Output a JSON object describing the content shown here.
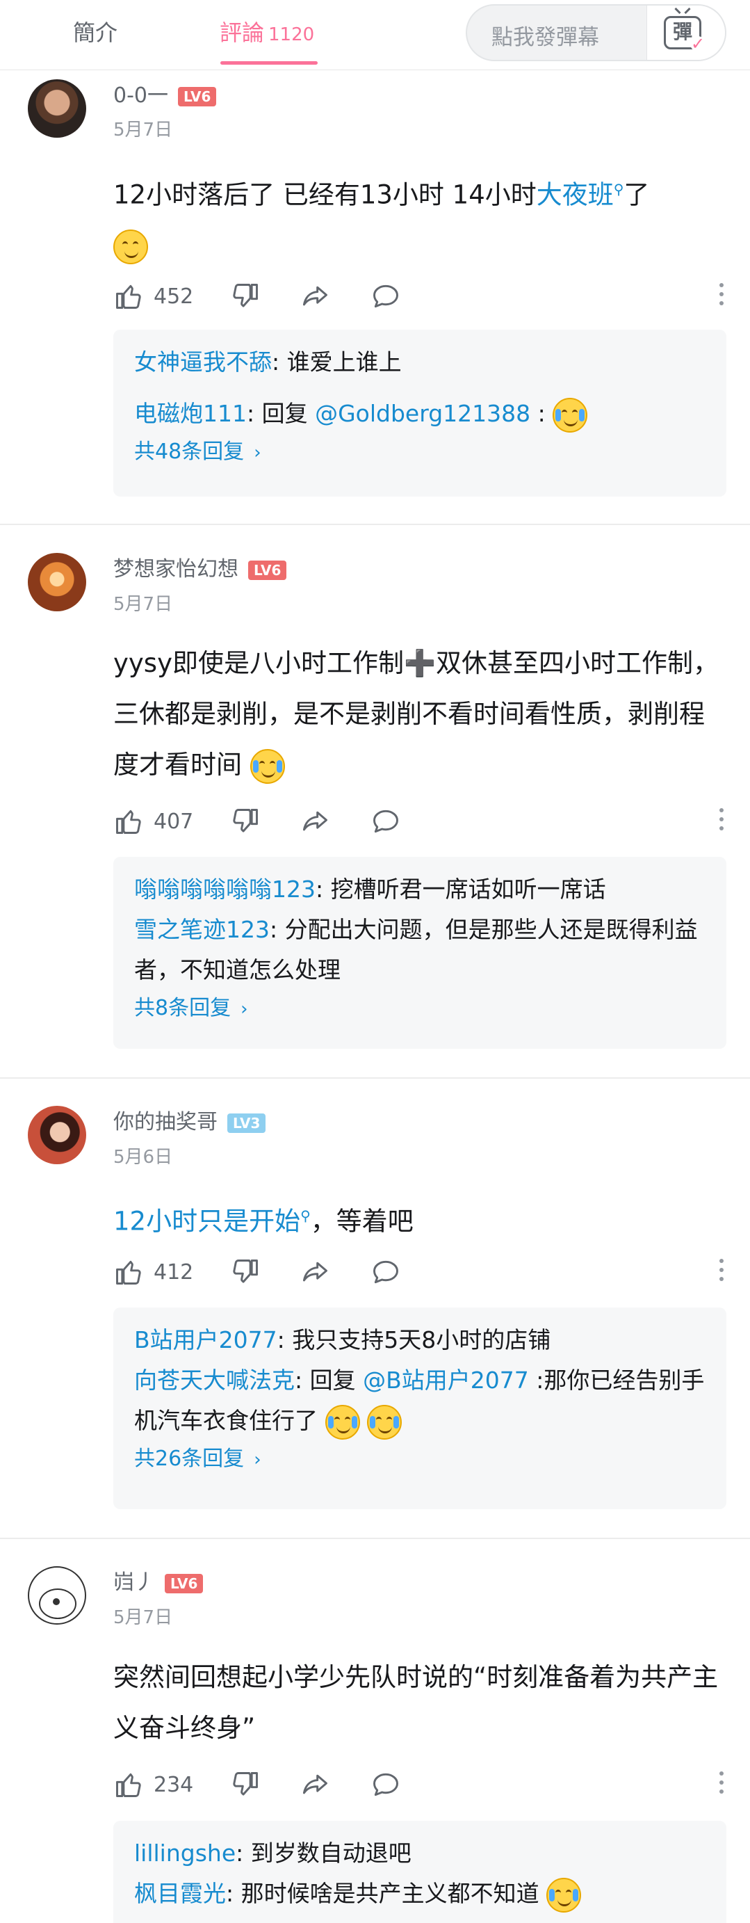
{
  "tabs": {
    "intro": "簡介",
    "comments": "評論",
    "comment_count": "1120",
    "danmaku_placeholder": "點我發彈幕",
    "danmaku_button": "彈"
  },
  "comments": [
    {
      "user": "0-0一",
      "level": "LV6",
      "date": "5月7日",
      "text_before": "12小时落后了 已经有13小时 14小时",
      "text_link": "大夜班",
      "text_after": "了",
      "likes": "452",
      "replies": [
        {
          "name": "女神逼我不舔",
          "text": ": 谁爱上谁上"
        },
        {
          "name": "电磁炮111",
          "text": ": 回复 ",
          "mention": "@Goldberg121388",
          "tail": " :"
        }
      ],
      "more": "共48条回复"
    },
    {
      "user": "梦想家怡幻想",
      "level": "LV6",
      "date": "5月7日",
      "text": "yysy即使是八小时工作制➕双休甚至四小时工作制，三休都是剥削，是不是剥削不看时间看性质，剥削程度才看时间",
      "likes": "407",
      "replies": [
        {
          "name": "嗡嗡嗡嗡嗡嗡123",
          "text": ": 挖槽听君一席话如听一席话"
        },
        {
          "name": "雪之笔迹123",
          "text": ": 分配出大问题，但是那些人还是既得利益者，不知道怎么处理"
        }
      ],
      "more": "共8条回复"
    },
    {
      "user": "你的抽奖哥",
      "level": "LV3",
      "date": "5月6日",
      "text_link": "12小时只是开始",
      "text_after": "，等着吧",
      "likes": "412",
      "replies": [
        {
          "name": "B站用户2077",
          "text": ": 我只支持5天8小时的店铺"
        },
        {
          "name": "向苍天大喊法克",
          "text": ": 回复 ",
          "mention": "@B站用户2077",
          "tail": " :那你已经告别手机汽车衣食住行了"
        }
      ],
      "more": "共26条回复"
    },
    {
      "user": "岿丿",
      "level": "LV6",
      "date": "5月7日",
      "text": "突然间回想起小学少先队时说的“时刻准备着为共产主义奋斗终身”",
      "likes": "234",
      "replies": [
        {
          "name": "lillingshe",
          "text": ": 到岁数自动退吧"
        },
        {
          "name": "枫目霞光",
          "text": ": 那时候啥是共产主义都不知道"
        }
      ]
    }
  ],
  "colors": {
    "accent": "#fb7299",
    "link": "#178bcf",
    "lv6": "#ee6c6c",
    "lv3": "#8ecff0"
  },
  "icons": [
    "thumbs-up-icon",
    "thumbs-down-icon",
    "share-icon",
    "reply-bubble-icon",
    "more-vertical-icon",
    "search-link-icon",
    "chevron-right-icon",
    "danmaku-icon"
  ]
}
